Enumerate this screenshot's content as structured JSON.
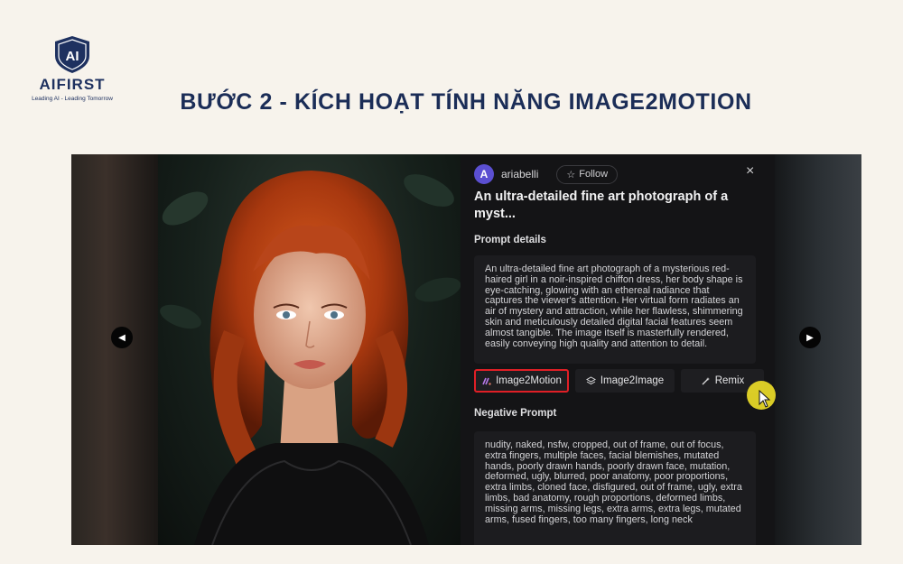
{
  "brand": {
    "logo_text": "AI",
    "name": "AIFIRST",
    "tagline": "Leading AI - Leading Tomorrow"
  },
  "page_title": "BƯỚC 2 - KÍCH HOẠT TÍNH NĂNG IMAGE2MOTION",
  "viewer": {
    "author": {
      "avatar_letter": "A",
      "username": "ariabelli",
      "follow_label": "Follow"
    },
    "close_icon": "×",
    "prompt_title": "An ultra-detailed fine art photograph of a myst...",
    "prompt_details_label": "Prompt details",
    "prompt_details": "An ultra-detailed fine art photograph of a mysterious red-haired girl in a noir-inspired chiffon dress, her body shape is eye-catching, glowing with an ethereal radiance that captures the viewer's attention. Her virtual form radiates an air of mystery and attraction, while her flawless, shimmering skin and meticulously detailed digital facial features seem almost tangible. The image itself is masterfully rendered, easily conveying high quality and attention to detail.",
    "actions": {
      "image2motion": "Image2Motion",
      "image2image": "Image2Image",
      "remix": "Remix"
    },
    "negative_prompt_label": "Negative Prompt",
    "negative_prompt": "nudity, naked, nsfw, cropped, out of frame, out of focus, extra fingers, multiple faces, facial blemishes, mutated hands, poorly drawn hands, poorly drawn face, mutation, deformed, ugly, blurred, poor anatomy, poor proportions, extra limbs, cloned face, disfigured, out of frame, ugly, extra limbs, bad anatomy, rough proportions, deformed limbs, missing arms, missing legs, extra arms, extra legs, mutated arms, fused fingers, too many fingers, long neck"
  },
  "colors": {
    "title": "#1b2d57",
    "highlight_border": "#e01f26",
    "cursor_highlight": "#ecdc28",
    "avatar": "#5b4fd1"
  },
  "icons": {
    "prev": "chevron-left-icon",
    "next": "chevron-right-icon",
    "follow": "star-icon",
    "image2motion": "motion-icon",
    "image2image": "layers-icon",
    "remix": "magic-wand-icon",
    "cursor": "mouse-pointer-icon"
  }
}
